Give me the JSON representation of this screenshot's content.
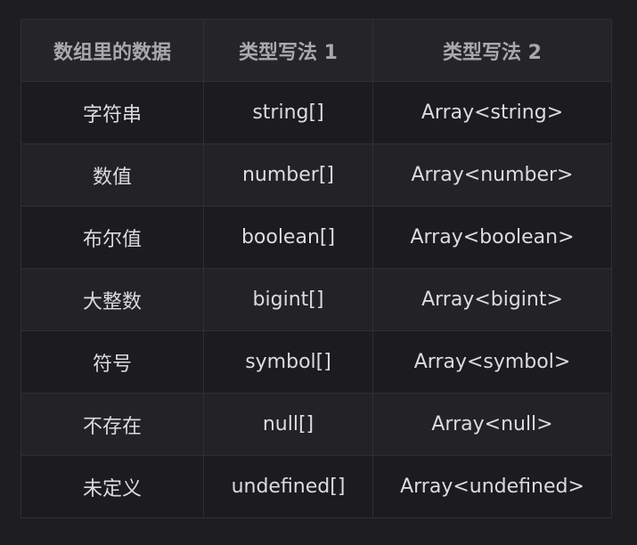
{
  "table": {
    "headers": [
      "数组里的数据",
      "类型写法 1",
      "类型写法 2"
    ],
    "rows": [
      [
        "字符串",
        "string[]",
        "Array<string>"
      ],
      [
        "数值",
        "number[]",
        "Array<number>"
      ],
      [
        "布尔值",
        "boolean[]",
        "Array<boolean>"
      ],
      [
        "大整数",
        "bigint[]",
        "Array<bigint>"
      ],
      [
        "符号",
        "symbol[]",
        "Array<symbol>"
      ],
      [
        "不存在",
        "null[]",
        "Array<null>"
      ],
      [
        "未定义",
        "undefined[]",
        "Array<undefined>"
      ]
    ]
  }
}
